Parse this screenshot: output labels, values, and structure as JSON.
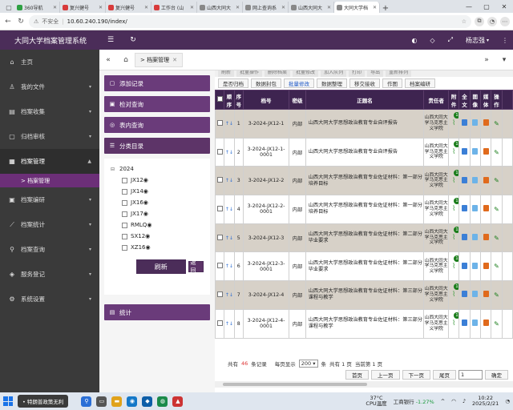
{
  "browser": {
    "tabs": [
      {
        "label": "360导航",
        "color": "#2ea043"
      },
      {
        "label": "复兴健号",
        "color": "#d83b3b"
      },
      {
        "label": "复兴健号",
        "color": "#d83b3b"
      },
      {
        "label": "工作台 (山",
        "color": "#d83b3b"
      },
      {
        "label": "山西大同大",
        "color": "#888888"
      },
      {
        "label": "网上查询系",
        "color": "#888888"
      },
      {
        "label": "山西大同大",
        "color": "#888888"
      },
      {
        "label": "大同大学档",
        "color": "#888888",
        "active": true
      }
    ],
    "insecure_label": "不安全",
    "url": "10.60.240.190/index/"
  },
  "app": {
    "title": "大同大学档案管理系统",
    "user_name": "杨志强"
  },
  "nav": {
    "items": [
      {
        "label": "主页",
        "icon": "home-icon",
        "glyph": "⌂"
      },
      {
        "label": "我的文件",
        "icon": "user-icon",
        "glyph": "♙"
      },
      {
        "label": "档案收集",
        "icon": "collect-icon",
        "glyph": "▤"
      },
      {
        "label": "归档审核",
        "icon": "audit-icon",
        "glyph": "▢"
      },
      {
        "label": "档案管理",
        "icon": "archive-icon",
        "glyph": "▦",
        "open": true
      }
    ],
    "sub_label": "> 档案管理",
    "items2": [
      {
        "label": "档案编研",
        "icon": "edit-icon",
        "glyph": "▣"
      },
      {
        "label": "档案统计",
        "icon": "chart-icon",
        "glyph": "⟋"
      },
      {
        "label": "档案查询",
        "icon": "search-icon",
        "glyph": "⚲"
      },
      {
        "label": "服务登记",
        "icon": "service-icon",
        "glyph": "◈"
      },
      {
        "label": "系统设置",
        "icon": "settings-icon",
        "glyph": "⚙"
      }
    ]
  },
  "page_tab": "> 档案管理",
  "panel": {
    "add_record": "添加记录",
    "inner_search": "检对查询",
    "outer_search": "表内查询",
    "category_dir": "分类目录",
    "stats": "统计",
    "tree_root": "2024",
    "tree_items": [
      "JX12◉",
      "JX14◉",
      "JX16◉",
      "JX17◉",
      "RMLQ◉",
      "SX12◉",
      "XZ16◉"
    ],
    "refresh_label": "刷新",
    "back_label": "返回"
  },
  "toolbar_top": [
    "刷新",
    "批量操作",
    "删除档案",
    "批量修改",
    "加入队列",
    "打印",
    "导出",
    "重新排列"
  ],
  "toolbar": [
    "是否归档",
    "数据封包",
    "批量修改",
    "数据整理",
    "移交接收",
    "作图",
    "档案编研"
  ],
  "table": {
    "headers": [
      "顺序",
      "序号",
      "档号",
      "密级",
      "正题名",
      "责任者",
      "附件",
      "全文",
      "图像",
      "媒体",
      "操作"
    ],
    "rows": [
      {
        "seq": "1",
        "code": "3-2024-JX12-1",
        "secret": "内部",
        "title": "山西大同大学思想政治教育专业自评报告",
        "resp": "山西大同大学马克思主义学院",
        "attach": 1
      },
      {
        "seq": "2",
        "code": "3-2024-JX12-1-0001",
        "secret": "内部",
        "title": "山西大同大学思想政治教育专业自评报告",
        "resp": "山西大同大学马克思主义学院",
        "attach": 1
      },
      {
        "seq": "3",
        "code": "3-2024-JX12-2",
        "secret": "内部",
        "title": "山西大同大学思想政治教育专业佐证材料：第一部分 培养目标",
        "resp": "山西大同大学马克思主义学院",
        "attach": 1
      },
      {
        "seq": "4",
        "code": "3-2024-JX12-2-0001",
        "secret": "内部",
        "title": "山西大同大学思想政治教育专业佐证材料：第一部分 培养目标",
        "resp": "山西大同大学马克思主义学院",
        "attach": 1
      },
      {
        "seq": "5",
        "code": "3-2024-JX12-3",
        "secret": "内部",
        "title": "山西大同大学思想政治教育专业佐证材料：第二部分 毕业要求",
        "resp": "山西大同大学马克思主义学院",
        "attach": 1
      },
      {
        "seq": "6",
        "code": "3-2024-JX12-3-0001",
        "secret": "内部",
        "title": "山西大同大学思想政治教育专业佐证材料：第二部分 毕业要求",
        "resp": "山西大同大学马克思主义学院",
        "attach": 1
      },
      {
        "seq": "7",
        "code": "3-2024-JX12-4",
        "secret": "内部",
        "title": "山西大同大学思想政治教育专业佐证材料：第三部分 课程与教学",
        "resp": "山西大同大学马克思主义学院",
        "attach": 1
      },
      {
        "seq": "8",
        "code": "3-2024-JX12-4-0001",
        "secret": "内部",
        "title": "山西大同大学思想政治教育专业佐证材料：第三部分 课程与教学",
        "resp": "山西大同大学马克思主义学院",
        "attach": 1
      }
    ]
  },
  "pager": {
    "total_prefix": "共有",
    "total": "46",
    "total_suffix": "条记录",
    "per_page_label": "每页显示",
    "per_page": "200",
    "per_page_suffix": "条",
    "pages_info": "共有 1 页",
    "current_info": "当前第 1 页",
    "first": "首页",
    "prev": "上一页",
    "next": "下一页",
    "last": "尾页",
    "page_input": "1",
    "confirm": "确定"
  },
  "taskbar": {
    "news": "特朗普政策无利",
    "temp": "37°C",
    "temp_label": "CPU温度",
    "stock_name": "工商银行",
    "stock_change": "-1.27%",
    "time": "10:22",
    "date": "2025/2/21"
  }
}
